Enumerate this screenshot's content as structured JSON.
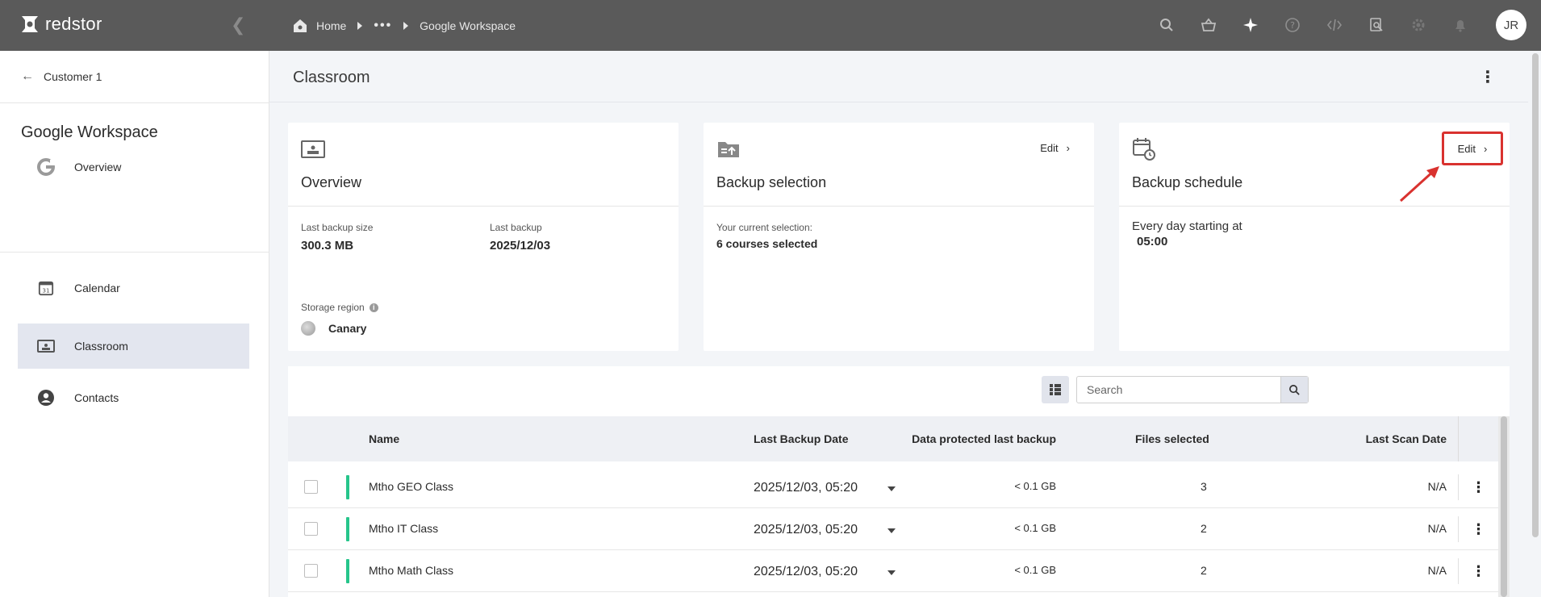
{
  "topbar": {
    "logo_text": "redstor",
    "breadcrumbs": [
      "Home",
      "•••",
      "Google Workspace"
    ],
    "avatar_initials": "JR"
  },
  "sidebar": {
    "back_label": "Customer 1",
    "title": "Google Workspace",
    "items": [
      {
        "label": "Overview"
      },
      {
        "label": "Calendar"
      },
      {
        "label": "Classroom"
      },
      {
        "label": "Contacts"
      }
    ]
  },
  "main": {
    "title": "Classroom"
  },
  "overview_card": {
    "title": "Overview",
    "last_backup_size_label": "Last backup size",
    "last_backup_size": "300.3 MB",
    "last_backup_label": "Last backup",
    "last_backup": "2025/12/03",
    "storage_region_label": "Storage region",
    "storage_region": "Canary"
  },
  "selection_card": {
    "title": "Backup selection",
    "edit_label": "Edit",
    "current_label": "Your current selection:",
    "current_value": "6 courses selected"
  },
  "schedule_card": {
    "title": "Backup schedule",
    "edit_label": "Edit",
    "schedule_text": "Every day starting at",
    "schedule_time": "05:00"
  },
  "table": {
    "search_placeholder": "Search",
    "columns": {
      "name": "Name",
      "last_backup_date": "Last Backup Date",
      "data_protected": "Data protected last backup",
      "files_selected": "Files selected",
      "last_scan_date": "Last Scan Date"
    },
    "rows": [
      {
        "name": "Mtho GEO Class",
        "date": "2025/12/03, 05:20",
        "data": "< 0.1 GB",
        "files": "3",
        "scan": "N/A"
      },
      {
        "name": "Mtho IT Class",
        "date": "2025/12/03, 05:20",
        "data": "< 0.1 GB",
        "files": "2",
        "scan": "N/A"
      },
      {
        "name": "Mtho Math Class",
        "date": "2025/12/03, 05:20",
        "data": "< 0.1 GB",
        "files": "2",
        "scan": "N/A"
      }
    ]
  },
  "colors": {
    "topbar": "#5a5a5a",
    "accent_green": "#26c58b",
    "highlight_red": "#d9322f",
    "active_nav": "#e3e6ef"
  }
}
